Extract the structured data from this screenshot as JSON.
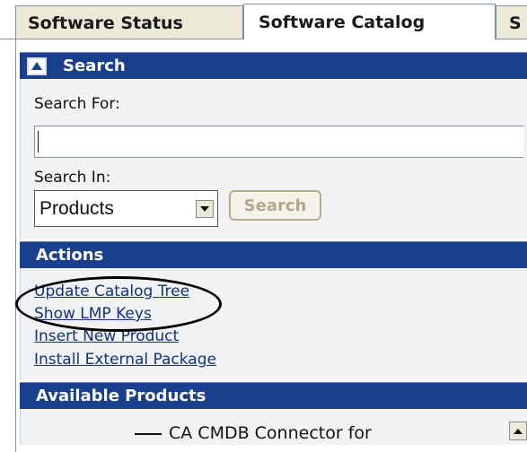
{
  "tabs": [
    {
      "label": "Software Status"
    },
    {
      "label": "Software Catalog"
    },
    {
      "label": "S"
    }
  ],
  "search_panel": {
    "title": "Search",
    "search_for_label": "Search For:",
    "search_for_value": "",
    "search_in_label": "Search In:",
    "search_in_value": "Products",
    "search_button": "Search"
  },
  "actions_panel": {
    "title": "Actions",
    "links": [
      {
        "label": "Update Catalog Tree"
      },
      {
        "label": "Show LMP Keys"
      },
      {
        "label": "Insert New Product"
      },
      {
        "label": "Install External Package"
      }
    ]
  },
  "products_panel": {
    "title": "Available Products",
    "first_item": "CA CMDB Connector for"
  }
}
